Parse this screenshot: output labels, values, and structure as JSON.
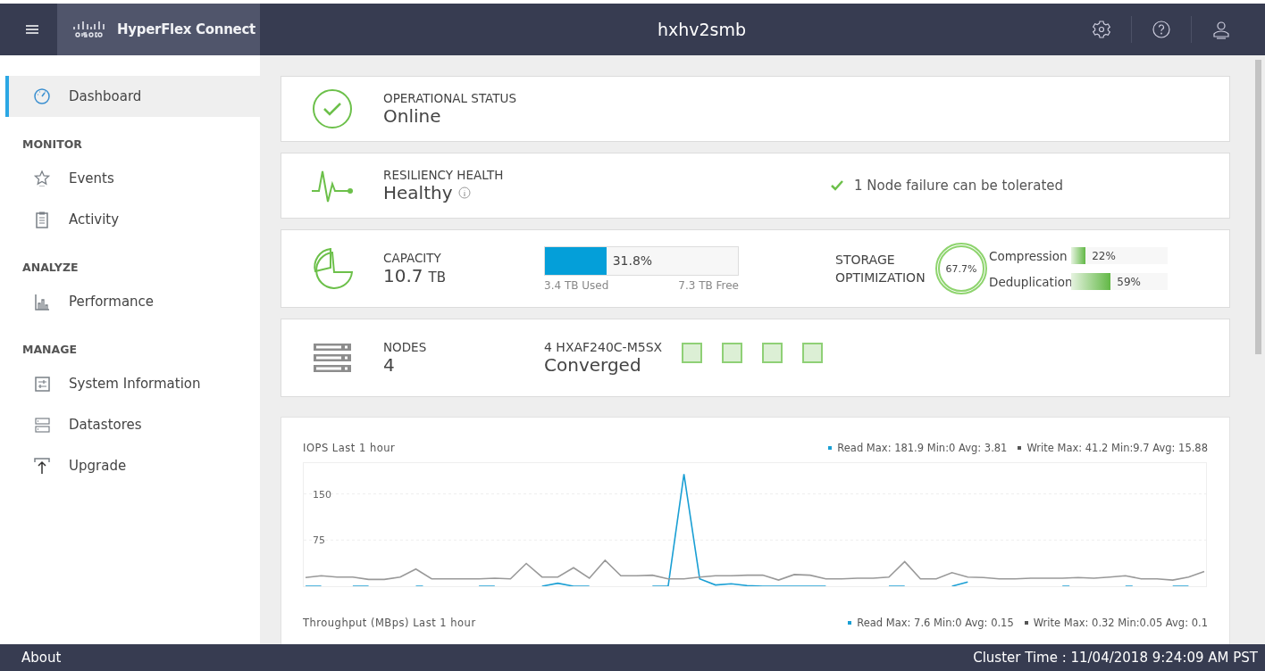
{
  "header": {
    "brand": "HyperFlex Connect",
    "title": "hxhv2smb"
  },
  "sidebar": {
    "items": [
      {
        "label": "Dashboard",
        "selected": true
      }
    ],
    "sections": [
      {
        "title": "MONITOR",
        "items": [
          {
            "label": "Events",
            "selected": false
          },
          {
            "label": "Activity",
            "selected": false
          }
        ]
      },
      {
        "title": "ANALYZE",
        "items": [
          {
            "label": "Performance",
            "selected": false
          }
        ]
      },
      {
        "title": "MANAGE",
        "items": [
          {
            "label": "System Information",
            "selected": false
          },
          {
            "label": "Datastores",
            "selected": false
          },
          {
            "label": "Upgrade",
            "selected": false
          }
        ]
      }
    ]
  },
  "operational_status": {
    "label": "OPERATIONAL STATUS",
    "value": "Online"
  },
  "resiliency_health": {
    "label": "RESILIENCY HEALTH",
    "value": "Healthy",
    "note": "1 Node failure can be tolerated"
  },
  "capacity": {
    "label": "CAPACITY",
    "value": "10.7",
    "unit": "TB",
    "level": 0.318,
    "percent": "31.8%",
    "used": "3.4 TB Used",
    "free": "7.3 TB Free"
  },
  "storage_optimization": {
    "label": "STORAGE OPTIMIZATION",
    "total": "67.7%",
    "bars": [
      {
        "name": "Compression",
        "value": "22%"
      },
      {
        "name": "Deduplication",
        "value": "59%"
      }
    ]
  },
  "nodes": {
    "label": "NODES",
    "count": "4",
    "model": "4 HXAF240C-M5SX",
    "type": "Converged",
    "items": [
      {
        "healthy": true
      },
      {
        "healthy": true
      },
      {
        "healthy": true
      },
      {
        "healthy": true
      }
    ]
  },
  "charts": [
    {
      "title": "IOPS Last 1 hour",
      "legend": [
        {
          "text": "Read Max: 181.9 Min:0 Avg: 3.81",
          "color": "#1a9fd4"
        },
        {
          "text": "Write Max: 41.2 Min:9.7 Avg: 15.88",
          "color": "#555555"
        }
      ],
      "chart_data": {
        "type": "line",
        "ylim": [
          0,
          200
        ],
        "yticks": [
          75,
          150
        ],
        "series": [
          {
            "color": "#1a9fd4",
            "values": [
              0,
              0,
              null,
              0,
              0,
              null,
              null,
              0,
              null,
              null,
              null,
              0,
              0,
              null,
              null,
              0,
              5,
              0,
              0,
              null,
              null,
              null,
              0,
              0,
              182,
              12,
              2,
              4,
              1,
              0,
              0,
              0,
              0,
              0,
              null,
              null,
              null,
              0,
              0,
              null,
              null,
              0,
              7,
              null,
              null,
              null,
              null,
              null,
              0,
              null,
              null,
              null,
              0,
              null,
              null,
              0,
              0,
              null
            ]
          },
          {
            "color": "#999999",
            "values": [
              14,
              17,
              15,
              15,
              11,
              11,
              15,
              28,
              12,
              12,
              12,
              12,
              13,
              12,
              37,
              15,
              15,
              30,
              13,
              42,
              17,
              17,
              18,
              12,
              12,
              15,
              17,
              17,
              18,
              18,
              10,
              19,
              18,
              12,
              12,
              13,
              13,
              15,
              40,
              12,
              12,
              22,
              15,
              14,
              12,
              12,
              13,
              13,
              13,
              14,
              13,
              15,
              17,
              12,
              12,
              10,
              15,
              24
            ]
          }
        ]
      }
    },
    {
      "title": "Throughput (MBps) Last 1 hour",
      "legend": [
        {
          "text": "Read Max: 7.6 Min:0 Avg: 0.15",
          "color": "#1a9fd4"
        },
        {
          "text": "Write Max: 0.32 Min:0.05 Avg: 0.1",
          "color": "#555555"
        }
      ]
    }
  ],
  "footer": {
    "about": "About",
    "cluster_time": "Cluster Time : 11/04/2018 9:24:09 AM PST"
  }
}
